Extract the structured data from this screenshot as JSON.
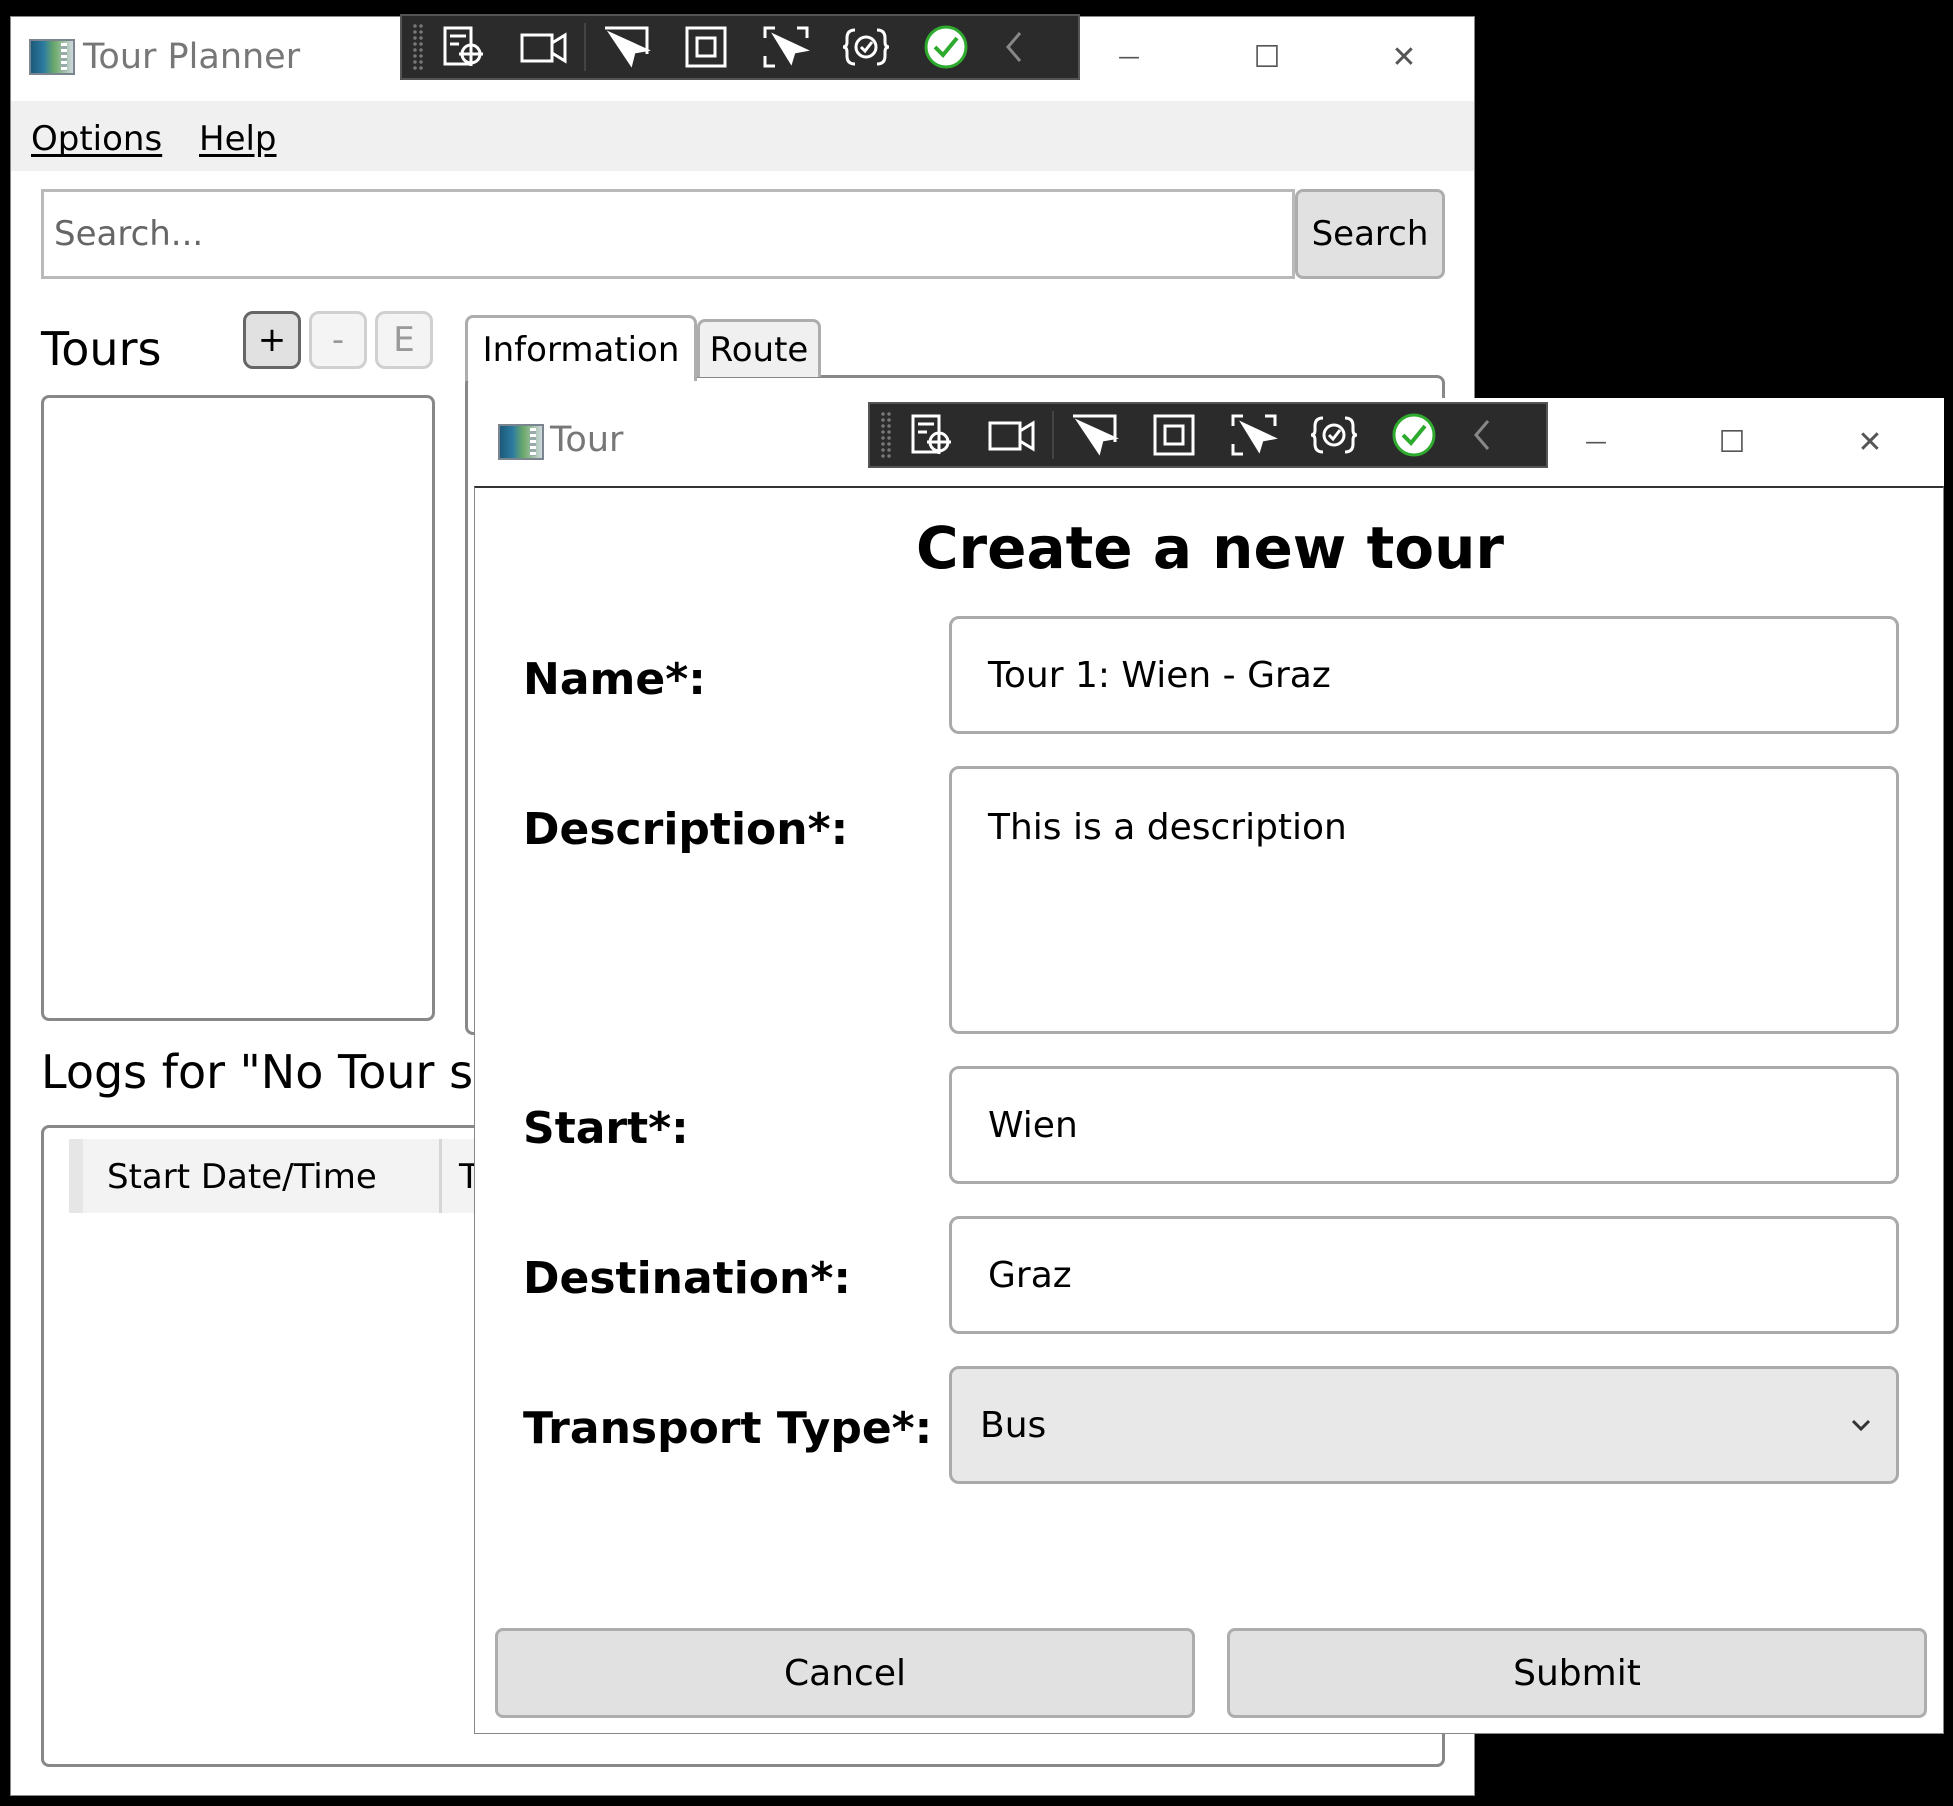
{
  "main_window": {
    "title": "Tour Planner",
    "menu": [
      "Options",
      "Help"
    ],
    "search": {
      "placeholder": "Search...",
      "button_label": "Search"
    },
    "tours": {
      "heading": "Tours",
      "add_label": "+",
      "remove_label": "-",
      "edit_label": "E"
    },
    "tabs": [
      {
        "label": "Information",
        "active": true
      },
      {
        "label": "Route",
        "active": false
      }
    ],
    "logs": {
      "heading": "Logs for \"No Tour sel",
      "columns": [
        "Start Date/Time",
        "T"
      ]
    },
    "window_controls": {
      "minimize": "—",
      "maximize": "☐",
      "close": "✕"
    }
  },
  "dialog": {
    "window_title": "Tour",
    "heading": "Create a new tour",
    "fields": {
      "name": {
        "label": "Name*:",
        "value": "Tour 1: Wien - Graz"
      },
      "description": {
        "label": "Description*:",
        "value": "This is a description"
      },
      "start": {
        "label": "Start*:",
        "value": "Wien"
      },
      "destination": {
        "label": "Destination*:",
        "value": "Graz"
      },
      "transport_type": {
        "label": "Transport Type*:",
        "value": "Bus"
      }
    },
    "buttons": {
      "cancel": "Cancel",
      "submit": "Submit"
    },
    "window_controls": {
      "minimize": "—",
      "maximize": "☐",
      "close": "✕"
    }
  },
  "debug_toolbar": {
    "icons": [
      "select-element-icon",
      "video-camera-icon",
      "pointer-select-icon",
      "layout-adorner-icon",
      "track-focus-icon",
      "binding-failures-icon",
      "accessibility-check-icon",
      "collapse-icon"
    ],
    "accent_green": "#2eaa2e"
  }
}
